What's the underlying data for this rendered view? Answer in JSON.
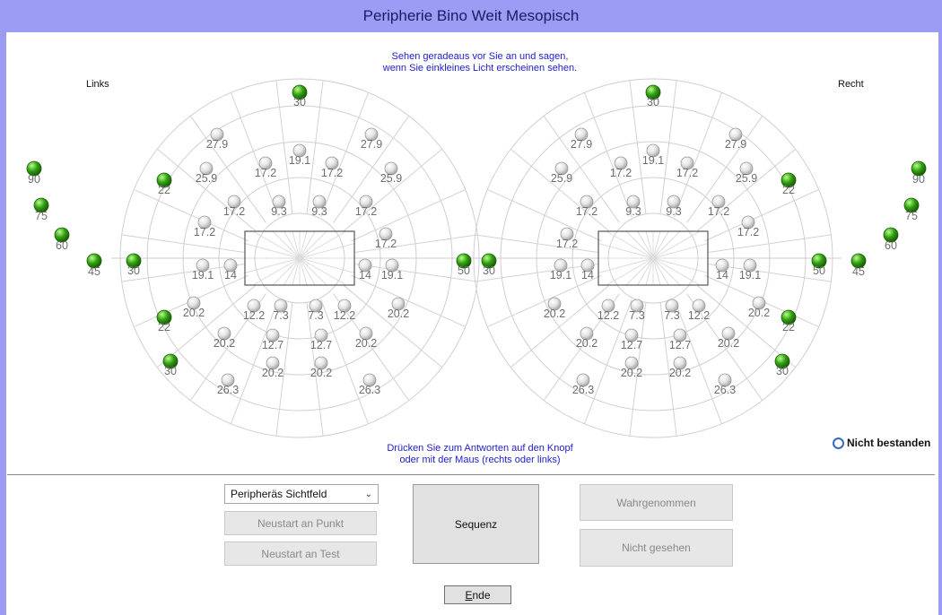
{
  "window": {
    "title": "Peripherie Bino Weit Mesopisch"
  },
  "instructions": {
    "top_line1": "Sehen geradeaus vor Sie an und sagen,",
    "top_line2": "wenn Sie einkleines Licht erscheinen sehen.",
    "bottom_line1": "Drücken Sie zum Antworten auf den Knopf",
    "bottom_line2": "oder mit der Maus (rechts oder links)"
  },
  "labels": {
    "left": "Links",
    "right": "Recht"
  },
  "colors": {
    "title_bar": "#9c9cf4",
    "instruction_text": "#2020cc",
    "passed": "#2e9e10",
    "untested": "#e4e4e4"
  },
  "legend": {
    "failed_label": "Nicht bestanden",
    "failed_icon": "ring-icon"
  },
  "left_field": {
    "outer_points": [
      {
        "label": "90",
        "status": "passed"
      },
      {
        "label": "75",
        "status": "passed"
      },
      {
        "label": "60",
        "status": "passed"
      },
      {
        "label": "45",
        "status": "passed"
      }
    ],
    "points": [
      {
        "label": "30",
        "status": "passed"
      },
      {
        "label": "27.9",
        "status": "untested"
      },
      {
        "label": "27.9",
        "status": "untested"
      },
      {
        "label": "19.1",
        "status": "untested"
      },
      {
        "label": "17.2",
        "status": "untested"
      },
      {
        "label": "17.2",
        "status": "untested"
      },
      {
        "label": "25.9",
        "status": "untested"
      },
      {
        "label": "25.9",
        "status": "untested"
      },
      {
        "label": "22",
        "status": "passed"
      },
      {
        "label": "17.2",
        "status": "untested"
      },
      {
        "label": "9.3",
        "status": "untested"
      },
      {
        "label": "9.3",
        "status": "untested"
      },
      {
        "label": "17.2",
        "status": "untested"
      },
      {
        "label": "17.2",
        "status": "untested"
      },
      {
        "label": "17.2",
        "status": "untested"
      },
      {
        "label": "30",
        "status": "passed"
      },
      {
        "label": "50",
        "status": "passed"
      },
      {
        "label": "19.1",
        "status": "untested"
      },
      {
        "label": "14",
        "status": "untested"
      },
      {
        "label": "14",
        "status": "untested"
      },
      {
        "label": "19.1",
        "status": "untested"
      },
      {
        "label": "20.2",
        "status": "untested"
      },
      {
        "label": "12.2",
        "status": "untested"
      },
      {
        "label": "7.3",
        "status": "untested"
      },
      {
        "label": "7.3",
        "status": "untested"
      },
      {
        "label": "12.2",
        "status": "untested"
      },
      {
        "label": "20.2",
        "status": "untested"
      },
      {
        "label": "22",
        "status": "passed"
      },
      {
        "label": "20.2",
        "status": "untested"
      },
      {
        "label": "12.7",
        "status": "untested"
      },
      {
        "label": "12.7",
        "status": "untested"
      },
      {
        "label": "20.2",
        "status": "untested"
      },
      {
        "label": "30",
        "status": "passed"
      },
      {
        "label": "20.2",
        "status": "untested"
      },
      {
        "label": "20.2",
        "status": "untested"
      },
      {
        "label": "26.3",
        "status": "untested"
      },
      {
        "label": "26.3",
        "status": "untested"
      }
    ]
  },
  "right_field": {
    "outer_points": [
      {
        "label": "90",
        "status": "passed"
      },
      {
        "label": "75",
        "status": "passed"
      },
      {
        "label": "60",
        "status": "passed"
      },
      {
        "label": "45",
        "status": "passed"
      }
    ],
    "points": [
      {
        "label": "30",
        "status": "passed"
      },
      {
        "label": "27.9",
        "status": "untested"
      },
      {
        "label": "27.9",
        "status": "untested"
      },
      {
        "label": "19.1",
        "status": "untested"
      },
      {
        "label": "17.2",
        "status": "untested"
      },
      {
        "label": "17.2",
        "status": "untested"
      },
      {
        "label": "25.9",
        "status": "untested"
      },
      {
        "label": "25.9",
        "status": "untested"
      },
      {
        "label": "22",
        "status": "passed"
      },
      {
        "label": "17.2",
        "status": "untested"
      },
      {
        "label": "9.3",
        "status": "untested"
      },
      {
        "label": "9.3",
        "status": "untested"
      },
      {
        "label": "17.2",
        "status": "untested"
      },
      {
        "label": "17.2",
        "status": "untested"
      },
      {
        "label": "17.2",
        "status": "untested"
      },
      {
        "label": "50",
        "status": "passed"
      },
      {
        "label": "30",
        "status": "passed"
      },
      {
        "label": "19.1",
        "status": "untested"
      },
      {
        "label": "14",
        "status": "untested"
      },
      {
        "label": "14",
        "status": "untested"
      },
      {
        "label": "19.1",
        "status": "untested"
      },
      {
        "label": "20.2",
        "status": "untested"
      },
      {
        "label": "12.2",
        "status": "untested"
      },
      {
        "label": "7.3",
        "status": "untested"
      },
      {
        "label": "7.3",
        "status": "untested"
      },
      {
        "label": "12.2",
        "status": "untested"
      },
      {
        "label": "20.2",
        "status": "untested"
      },
      {
        "label": "22",
        "status": "passed"
      },
      {
        "label": "20.2",
        "status": "untested"
      },
      {
        "label": "12.7",
        "status": "untested"
      },
      {
        "label": "12.7",
        "status": "untested"
      },
      {
        "label": "20.2",
        "status": "untested"
      },
      {
        "label": "30",
        "status": "passed"
      },
      {
        "label": "20.2",
        "status": "untested"
      },
      {
        "label": "20.2",
        "status": "untested"
      },
      {
        "label": "26.3",
        "status": "untested"
      },
      {
        "label": "26.3",
        "status": "untested"
      }
    ]
  },
  "controls": {
    "mode_select": {
      "value": "Peripheräs Sichtfeld"
    },
    "restart_point": "Neustart an Punkt",
    "restart_test": "Neustart an Test",
    "sequence": "Sequenz",
    "perceived": "Wahrgenommen",
    "not_seen": "Nicht gesehen",
    "end_mnemonic": "E",
    "end_rest": "nde"
  }
}
